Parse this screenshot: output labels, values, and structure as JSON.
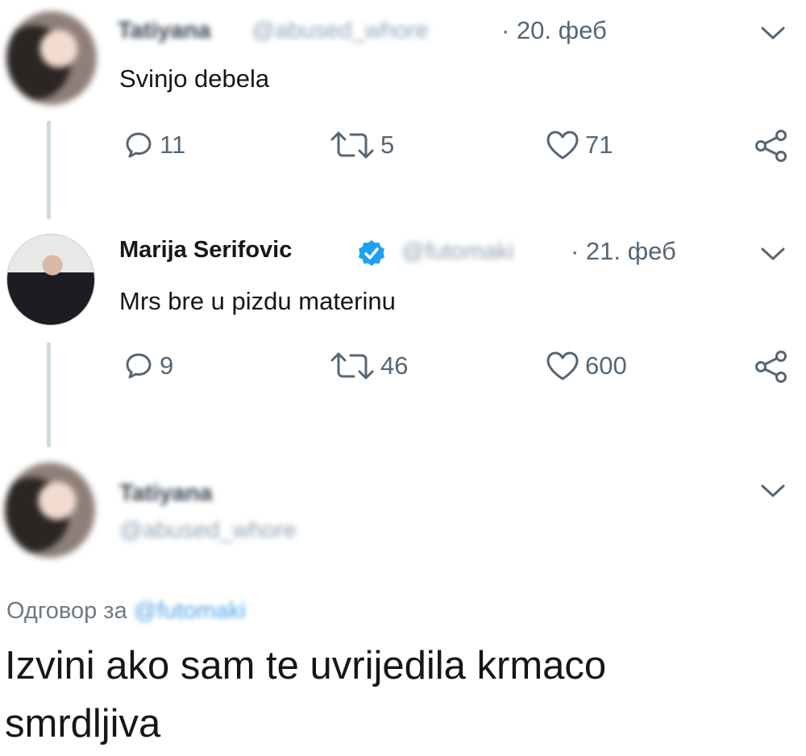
{
  "tweets": [
    {
      "name": "Tatiyana",
      "handle": "@abused_whore",
      "date": "· 20. феб",
      "text": "Svinjo debela",
      "replies": "11",
      "retweets": "5",
      "likes": "71"
    },
    {
      "name": "Marija Serifovic",
      "handle": "@futomaki",
      "date": "· 21. феб",
      "text": "Mrs bre u pizdu materinu",
      "replies": "9",
      "retweets": "46",
      "likes": "600"
    }
  ],
  "reply": {
    "name": "Tatiyana",
    "handle": "@abused_whore",
    "reply_to_label": "Одговор за",
    "reply_to_handle": "@futomaki",
    "text_line1": "Izvini ako sam te uvrijedila krmaco",
    "text_line2": "smrdljiva"
  },
  "colors": {
    "text": "#14171a",
    "muted": "#556674",
    "verified": "#1da1f2",
    "thread_line": "#cfd9de"
  },
  "icons": [
    "reply-icon",
    "retweet-icon",
    "like-icon",
    "share-icon",
    "chevron-down-icon",
    "verified-badge-icon"
  ]
}
